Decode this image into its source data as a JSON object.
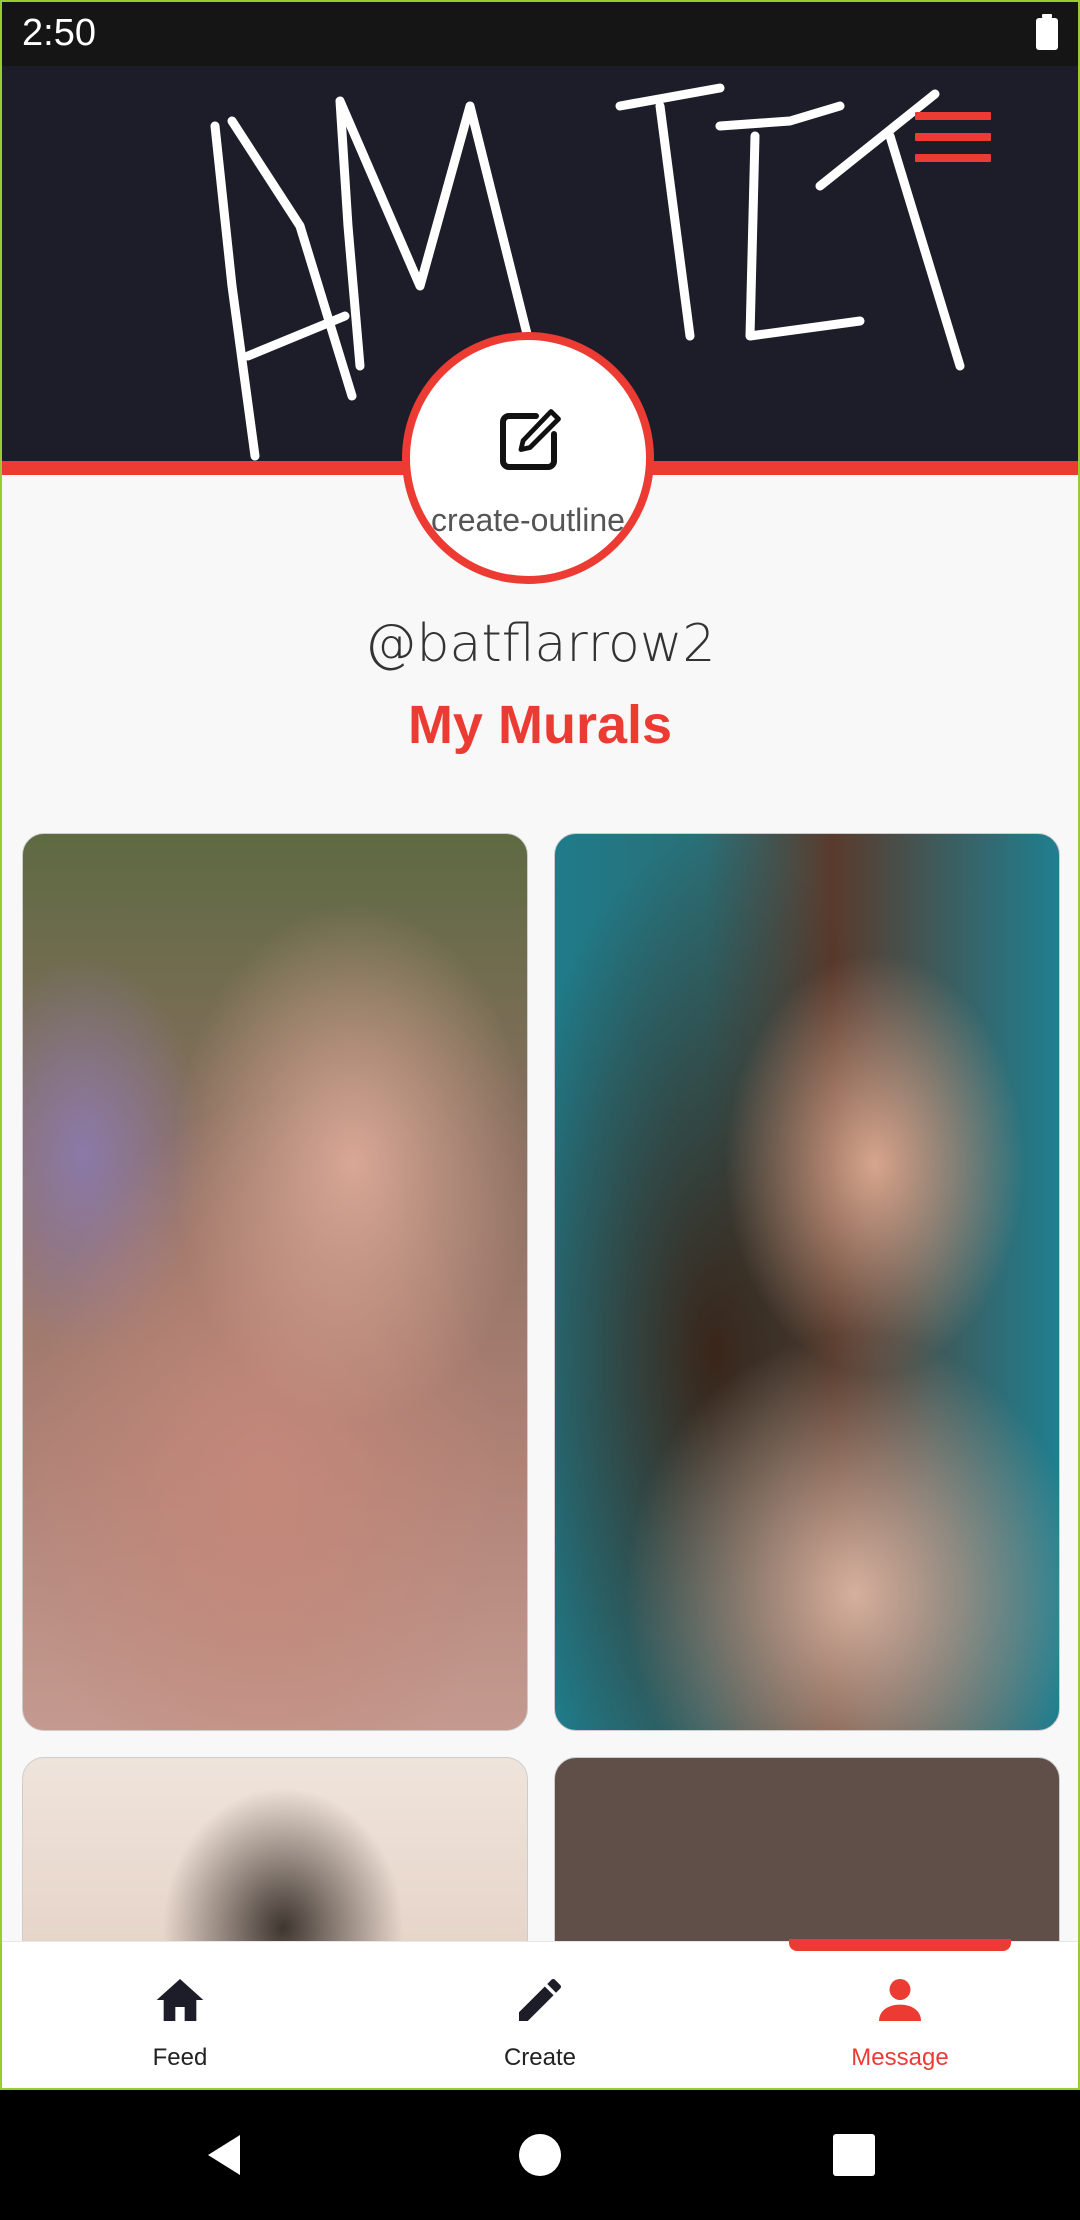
{
  "status_bar": {
    "time": "2:50",
    "battery_icon": "battery-full-icon"
  },
  "banner": {
    "signature_text": "AMIT",
    "menu_icon": "hamburger-menu-icon",
    "accent_color": "#ec3b33",
    "background_color": "#1d1d29"
  },
  "profile": {
    "avatar_icon": "create-outline-icon",
    "avatar_label": "create-outline",
    "username": "@batflarrow2"
  },
  "section": {
    "title": "My Murals"
  },
  "murals": [
    {
      "name": "mural-1"
    },
    {
      "name": "mural-2"
    },
    {
      "name": "mural-3"
    },
    {
      "name": "mural-4"
    }
  ],
  "bottom_nav": {
    "items": [
      {
        "label": "Feed",
        "icon": "home-icon",
        "active": false
      },
      {
        "label": "Create",
        "icon": "pencil-icon",
        "active": false
      },
      {
        "label": "Message",
        "icon": "person-icon",
        "active": true
      }
    ],
    "active_color": "#ec3b33"
  },
  "system_nav": {
    "buttons": [
      "back-icon",
      "home-circle-icon",
      "recents-icon"
    ]
  }
}
